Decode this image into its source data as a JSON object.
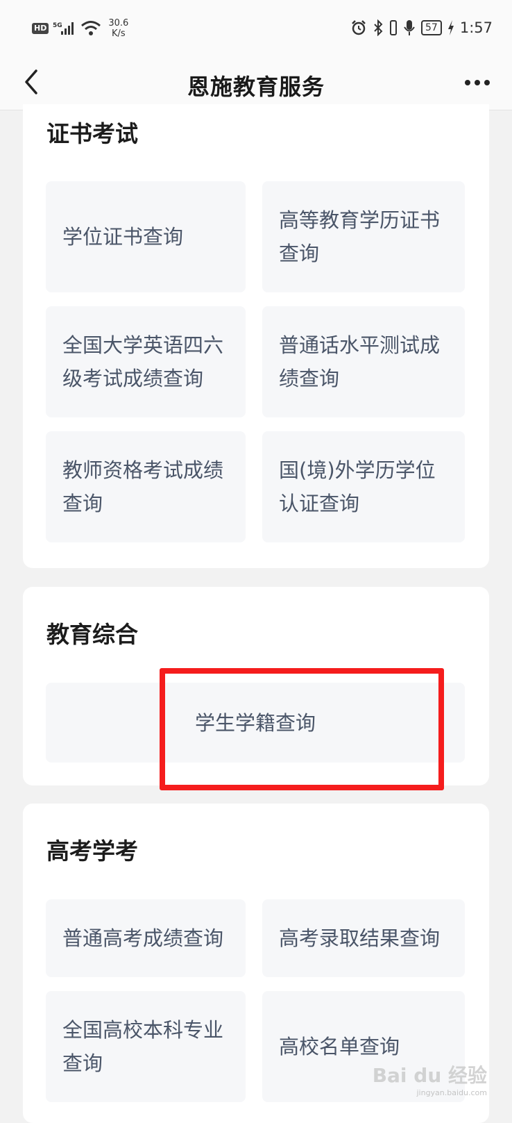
{
  "status_bar": {
    "hd_badge": "HD",
    "signal_label": "5G",
    "net_speed_value": "30.6",
    "net_speed_unit": "K/s",
    "battery": "57",
    "time": "1:57"
  },
  "nav": {
    "title": "恩施教育服务"
  },
  "sections": {
    "cert": {
      "title": "证书考试",
      "items": [
        "学位证书查询",
        "高等教育学历证书查询",
        "全国大学英语四六级考试成绩查询",
        "普通话水平测试成绩查询",
        "教师资格考试成绩查询",
        "国(境)外学历学位认证查询"
      ]
    },
    "edu": {
      "title": "教育综合",
      "items": [
        "学生学籍查询"
      ]
    },
    "gaokao": {
      "title": "高考学考",
      "items": [
        "普通高考成绩查询",
        "高考录取结果查询",
        "全国高校本科专业查询",
        "高校名单查询"
      ]
    }
  },
  "watermark": {
    "brand": "Bai du 经验",
    "url": "jingyan.baidu.com"
  },
  "colors": {
    "highlight": "#f51d1d",
    "tile_bg": "#f6f7f9",
    "tile_text": "#4a5568"
  }
}
